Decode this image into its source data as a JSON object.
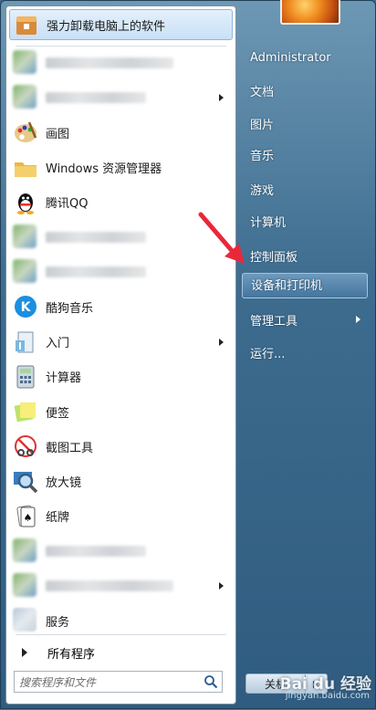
{
  "left_panel": {
    "pinned": [
      {
        "label": "强力卸载电脑上的软件",
        "icon": "uninstall-box-icon",
        "highlight": true
      }
    ],
    "recent": [
      {
        "label": "",
        "icon": "blurred-app-icon",
        "blurred": true,
        "arrow": false
      },
      {
        "label": "",
        "icon": "blurred-app-icon",
        "blurred": true,
        "arrow": true
      },
      {
        "label": "画图",
        "icon": "paint-palette-icon"
      },
      {
        "label": "Windows 资源管理器",
        "icon": "folder-explorer-icon"
      },
      {
        "label": "腾讯QQ",
        "icon": "qq-penguin-icon"
      },
      {
        "label": "",
        "icon": "blurred-app-icon",
        "blurred": true
      },
      {
        "label": "",
        "icon": "blurred-app-icon",
        "blurred": true
      },
      {
        "label": "酷狗音乐",
        "icon": "kugou-music-icon"
      },
      {
        "label": "入门",
        "icon": "getting-started-icon",
        "arrow": true
      },
      {
        "label": "计算器",
        "icon": "calculator-icon"
      },
      {
        "label": "便签",
        "icon": "sticky-notes-icon"
      },
      {
        "label": "截图工具",
        "icon": "snipping-tool-icon"
      },
      {
        "label": "放大镜",
        "icon": "magnifier-icon"
      },
      {
        "label": "纸牌",
        "icon": "solitaire-cards-icon"
      },
      {
        "label": "",
        "icon": "blurred-app-icon",
        "blurred": true
      },
      {
        "label": "",
        "icon": "blurred-app-icon",
        "blurred": true,
        "arrow": true
      },
      {
        "label": "服务",
        "icon": "services-gear-icon"
      }
    ],
    "all_programs": "所有程序",
    "search_placeholder": "搜索程序和文件"
  },
  "right_panel": {
    "items": [
      {
        "label": "Administrator"
      },
      {
        "label": "文档"
      },
      {
        "label": "图片"
      },
      {
        "label": "音乐"
      },
      {
        "label": "游戏"
      },
      {
        "label": "计算机"
      },
      {
        "label": "控制面板"
      },
      {
        "label": "设备和打印机",
        "hot": true
      },
      {
        "label": "管理工具",
        "arrow": true
      },
      {
        "label": "运行..."
      }
    ],
    "shutdown_label": "关机"
  },
  "watermark": {
    "brand": "Bai du 经验",
    "url": "jingyan.baidu.com"
  },
  "colors": {
    "annotation_arrow": "#e8283a",
    "highlight": "#c8e0f6"
  }
}
